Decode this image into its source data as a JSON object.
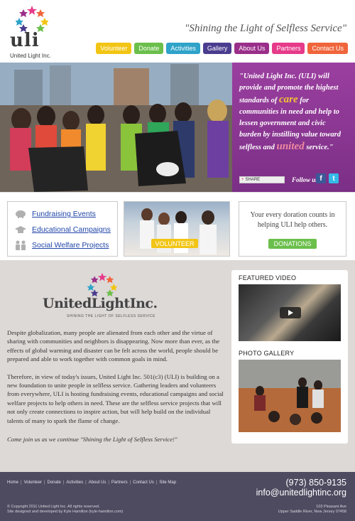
{
  "header": {
    "logo_text": "uli",
    "logo_sub": "United Light Inc.",
    "tagline": "\"Shining the Light of Selfless Service\"",
    "nav": [
      {
        "label": "Volunteer",
        "color": "#f2c514"
      },
      {
        "label": "Donate",
        "color": "#6bbf4b"
      },
      {
        "label": "Activities",
        "color": "#2fa3c9"
      },
      {
        "label": "Gallery",
        "color": "#4a3d8f"
      },
      {
        "label": "About Us",
        "color": "#9a2f8a"
      },
      {
        "label": "Partners",
        "color": "#e63a8a"
      },
      {
        "label": "Contact Us",
        "color": "#f0653c"
      }
    ]
  },
  "hero": {
    "quote_part1": "\"United Light Inc. (ULI) will provide and promote the highest standards of",
    "care": "care",
    "quote_part2": "for communities in need and help to lessen government and civic burden by instilling value toward selfless and",
    "united": "united",
    "quote_part3": "service.\"",
    "share": "SHARE",
    "follow_label": "Follow us:",
    "social": [
      {
        "icon": "facebook-icon",
        "glyph": "f",
        "color": "#3b5998"
      },
      {
        "icon": "twitter-icon",
        "glyph": "t",
        "color": "#33bbe8"
      }
    ]
  },
  "links": [
    {
      "label": "Fundraising Events",
      "icon": "piggy-bank-icon"
    },
    {
      "label": "Educational Campaigns",
      "icon": "graduation-cap-icon"
    },
    {
      "label": "Social Welfare Projects",
      "icon": "people-icon"
    }
  ],
  "volunteer_button": "VOLUNTEER",
  "donation": {
    "text": "Your every doration counts in helping ULI help others.",
    "button": "DONATIONS"
  },
  "about": {
    "logo_name": "UnitedLightInc.",
    "logo_sub": "SHINING THE LIGHT OF SELFLESS SERVICE",
    "para1": "Despite globalization, many people are alienated from each other and the virtue of sharing with communities and neighbors is disappearing. Now more than ever, as the effects of global warming and disaster can be felt across the world, people should be prepared and able to work together with common goals in mind.",
    "para2": "Therefore, in view of today's issues, United Light Inc. 501(c3) (ULI) is building on a new foundation to unite people in selfless service. Gathering leaders and volunteers from everywhere, ULI is hosting fundraising events, educational campaigns and social welfare projects to help others in need. These are the selfless service projects that will not only create connections to inspire action, but will help build on the individual talents of many to spark the flame of change.",
    "closing": "Come join us as we continue \"Shining the Light of Selfless Service!\""
  },
  "sidebar": {
    "video_title": "FEATURED VIDEO",
    "gallery_title": "PHOTO GALLERY"
  },
  "footer": {
    "links": [
      "Home",
      "Volunteer",
      "Donate",
      "Activities",
      "About Us",
      "Partners",
      "Contact Us",
      "Site Map"
    ],
    "phone": "(973) 850-9135",
    "email": "info@unitedlightinc.org",
    "copyright": "© Copyright 2011 United Light Inc. All rights reserved.",
    "credit": "Site designed and developed by Kyle Hamilton (kyle-hamilton.com)",
    "address1": "103 Pleasant Ave",
    "address2": "Upper Saddle River, New Jersey 07458"
  }
}
